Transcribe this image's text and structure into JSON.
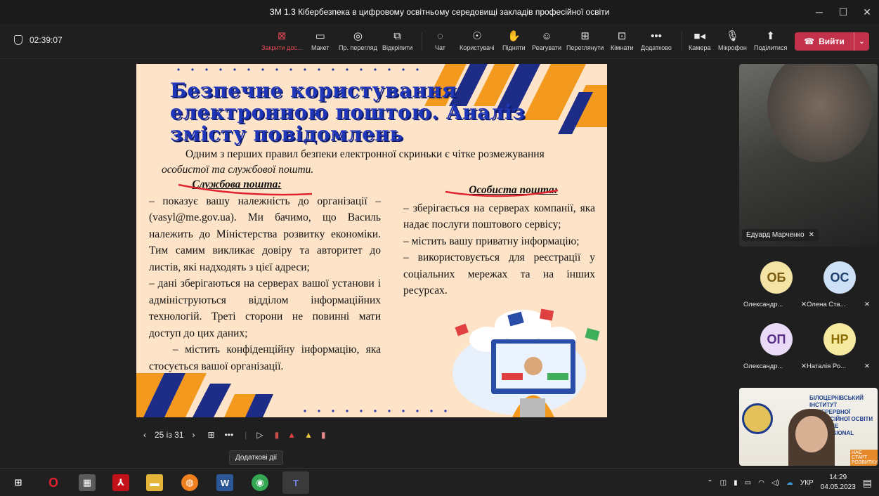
{
  "window": {
    "title": "ЗМ 1.3 Кібербезпека в цифровому освітньому середовищі закладів професійної освіти"
  },
  "meeting": {
    "timer": "02:39:07"
  },
  "toolbar": {
    "items": [
      {
        "label": "Закрити дос...",
        "icon": "close-share-icon"
      },
      {
        "label": "Макет",
        "icon": "layout-icon"
      },
      {
        "label": "Пр. перегляд",
        "icon": "preview-icon"
      },
      {
        "label": "Відкріпити",
        "icon": "popout-icon"
      },
      {
        "label": "Чат",
        "icon": "chat-icon"
      },
      {
        "label": "Користувачі",
        "icon": "people-icon"
      },
      {
        "label": "Підняти",
        "icon": "raise-hand-icon"
      },
      {
        "label": "Реагувати",
        "icon": "react-icon"
      },
      {
        "label": "Переглянути",
        "icon": "view-icon"
      },
      {
        "label": "Кімнати",
        "icon": "rooms-icon"
      },
      {
        "label": "Додатково",
        "icon": "more-icon"
      },
      {
        "label": "Камера",
        "icon": "camera-icon"
      },
      {
        "label": "Мікрофон",
        "icon": "mic-icon"
      },
      {
        "label": "Поділитися",
        "icon": "share-icon"
      }
    ],
    "leave_label": "Вийти"
  },
  "slide": {
    "title": "Безпечне користування електронною поштою. Аналіз змісту повідомлень",
    "intro_line1": "Одним з перших правил безпеки електронної скриньки є чітке розмежування",
    "intro_line2": "особистої та службової пошти.",
    "left_header": "Службова пошта:",
    "left_p1": "– показує вашу належність до організації – (vasyl@me.gov.ua). Ми бачимо, що Василь належить до Міністерства розвитку економіки. Тим самим викликає довіру та авторитет до листів, які надходять з цієї адреси;",
    "left_p2": "– дані зберігаються на серверах вашої установи і адмініструються відділом інформаційних технологій. Треті сторони не повинні мати доступ до цих даних;",
    "left_p3": "– містить конфіденційну інформацію, яка стосується вашої організації.",
    "right_header": "Особиста пошта:",
    "right_p1": "– зберігається на серверах компанії, яка надає послуги поштового сервісу;",
    "right_p2": "– містить вашу приватну інформацію;",
    "right_p3": "– використовується для реєстрації у соціальних мережах та на інших ресурсах."
  },
  "slidenav": {
    "counter": "25 із 31",
    "tooltip": "Додаткові дії"
  },
  "participants": {
    "main_video_name": "Едуард Марченко",
    "tiles": [
      {
        "initials": "ОБ",
        "name": "Олександр...",
        "bg": "#f3e3a4",
        "fg": "#7a5a10"
      },
      {
        "initials": "ОС",
        "name": "Олена Ста...",
        "bg": "#cde0f5",
        "fg": "#1d3f6b"
      },
      {
        "initials": "ОП",
        "name": "Олександр...",
        "bg": "#e9dbf7",
        "fg": "#5b2f87"
      },
      {
        "initials": "НР",
        "name": "Наталія Ро...",
        "bg": "#f6e9a0",
        "fg": "#8a6d00"
      }
    ],
    "small_video_text": [
      "БІЛОЦЕРКІВСЬКИЙ ІНСТИТУТ",
      "НЕПЕРЕРВНОЇ ПРОФЕСІЙНОЇ ОСВІТИ",
      "INSTITUTE",
      "PROFESSIONAL",
      "НАЄ СТАРТ",
      "РОЗВИТКУ"
    ]
  },
  "taskbar": {
    "lang": "УКР",
    "time": "14:29",
    "date": "04.05.2023"
  },
  "colors": {
    "accent_red": "#c4314b",
    "slide_bg": "#fde3c7",
    "title_blue": "#1f36b8"
  }
}
